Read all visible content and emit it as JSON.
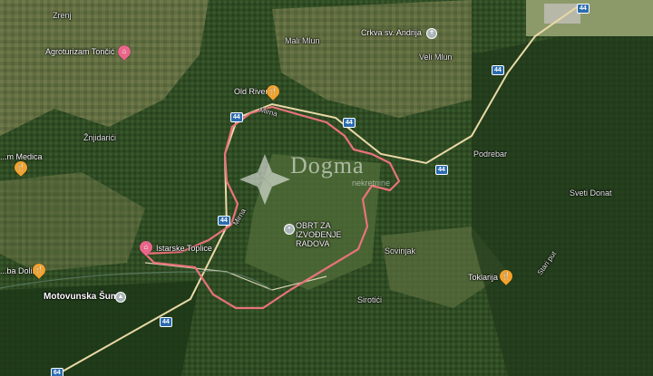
{
  "map": {
    "labels": {
      "zrenj": "Zrenj",
      "agroturizam": "Agroturizam Tončić",
      "mali_mlun": "Mali Mlun",
      "crkva": "Crkva sv. Andrija",
      "veli_mlun": "Veli Mlun",
      "old_river": "Old River",
      "znjidari": "Žnjidarići",
      "medica": "...m Medica",
      "podrebar": "Podrebar",
      "sveti_donat": "Sveti Donat",
      "obrt": "OBRT ZA IZVOĐENJE RADOVA",
      "sovinjak": "Sovinjak",
      "istarske": "Istarske Toplice",
      "dolina": "...ba Dolina",
      "motovunska": "Motovunska Šuma",
      "toklarija": "Toklarija",
      "sirotici": "Sirotići",
      "mirna_1": "Mirna",
      "mirna_2": "Mirna",
      "road_side": "Stari put"
    },
    "shields": {
      "r44": "44",
      "r64": "64"
    },
    "watermark": {
      "brand": "Dogma",
      "sub": "nekretnine"
    },
    "colors": {
      "boundary": "#e8737a",
      "road": "#e9d9a6",
      "forest": "#2f4a24",
      "field": "#8a8a55"
    }
  }
}
